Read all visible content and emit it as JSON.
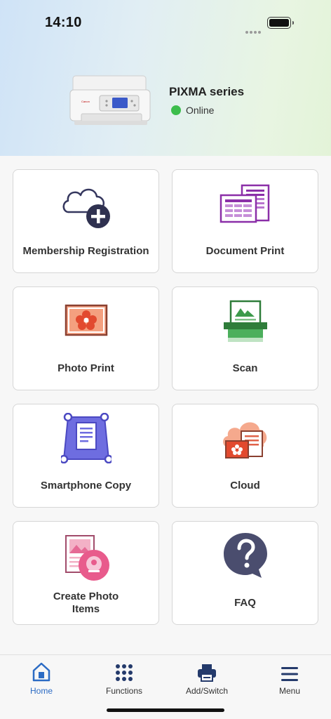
{
  "status_bar": {
    "time": "14:10"
  },
  "printer": {
    "name": "PIXMA series",
    "status": "Online",
    "status_color": "#3cbd4c"
  },
  "tiles": [
    {
      "label": "Membership Registration",
      "icon": "cloud-add-icon"
    },
    {
      "label": "Document Print",
      "icon": "document-icon"
    },
    {
      "label": "Photo Print",
      "icon": "photo-icon"
    },
    {
      "label": "Scan",
      "icon": "scanner-icon"
    },
    {
      "label": "Smartphone Copy",
      "icon": "smartphone-copy-icon"
    },
    {
      "label": "Cloud",
      "icon": "cloud-photo-icon"
    },
    {
      "label": "Create Photo Items",
      "icon": "photo-items-icon"
    },
    {
      "label": "FAQ",
      "icon": "question-bubble-icon"
    }
  ],
  "tabbar": [
    {
      "label": "Home",
      "icon": "home-icon",
      "active": true
    },
    {
      "label": "Functions",
      "icon": "grid-dots-icon"
    },
    {
      "label": "Add/Switch",
      "icon": "printer-icon"
    },
    {
      "label": "Menu",
      "icon": "hamburger-icon"
    }
  ],
  "accent_color": "#2b6bc4"
}
